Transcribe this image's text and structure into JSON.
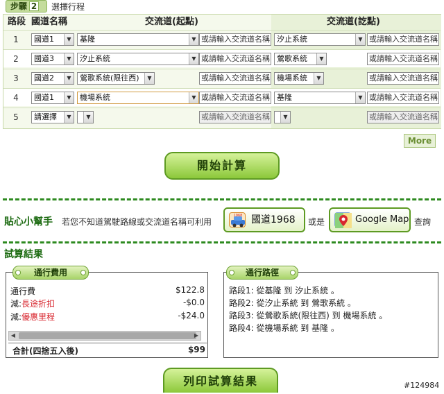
{
  "step": {
    "label": "步驟",
    "number": "2",
    "title": "選擇行程"
  },
  "table": {
    "headers": {
      "seq": "路段",
      "highway": "國道名稱",
      "start": "交流道(起點)",
      "end": "交流道(訖點)"
    },
    "rows": [
      {
        "seq": "1",
        "highway": "國道1",
        "start": "基隆",
        "start_input": "或請輸入交流道名稱",
        "end": "汐止系統",
        "end_input": "或請輸入交流道名稱"
      },
      {
        "seq": "2",
        "highway": "國道3",
        "start": "汐止系統",
        "start_input": "或請輸入交流道名稱",
        "end": "鶯歌系統",
        "end_input": "或請輸入交流道名稱"
      },
      {
        "seq": "3",
        "highway": "國道2",
        "start": "鶯歌系統(限往西)",
        "start_input": "或請輸入交流道名稱",
        "end": "機場系統",
        "end_input": "或請輸入交流道名稱"
      },
      {
        "seq": "4",
        "highway": "國道1",
        "start": "機場系統",
        "start_input": "或請輸入交流道名稱",
        "end": "基隆",
        "end_input": "或請輸入交流道名稱"
      },
      {
        "seq": "5",
        "highway": "請選擇",
        "start": "",
        "start_input": "或請輸入交流道名稱",
        "end": "",
        "end_input": "或請輸入交流道名稱"
      }
    ]
  },
  "more_label": "More",
  "calc_label": "開始計算",
  "helper": {
    "label": "貼心小幫手",
    "text": "若您不知道駕駛路線或交流道名稱可利用",
    "link1": "國道1968",
    "link1_icon_text": "1968",
    "or": "或是",
    "link2": "Google Map",
    "query": "查詢"
  },
  "result": {
    "title": "試算結果",
    "fee_tab": "通行費用",
    "path_tab": "通行路徑",
    "fees": [
      {
        "label": "通行費",
        "value": "$122.8"
      },
      {
        "label_prefix": "減:",
        "label_link": "長途折扣",
        "value": "-$0.0"
      },
      {
        "label_prefix": "減:",
        "label_link": "優惠里程",
        "value": "-$24.0"
      }
    ],
    "total_label": "合計(四捨五入後)",
    "total_value": "$99",
    "paths": [
      "路段1: 從基隆 到 汐止系統 。",
      "路段2: 從汐止系統 到 鶯歌系統 。",
      "路段3: 從鶯歌系統(限往西) 到 機場系統 。",
      "路段4: 從機場系統 到 基隆 。"
    ]
  },
  "print_label": "列印試算結果",
  "watermark": "#124984",
  "colors": {
    "brand_green": "#2d8a1f",
    "button_green": "#8cc83a",
    "discount_red": "#d8262e"
  }
}
